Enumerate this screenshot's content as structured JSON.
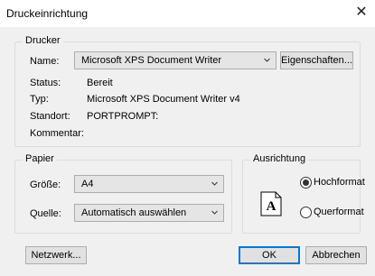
{
  "window": {
    "title": "Druckeinrichtung",
    "close_glyph": "✕"
  },
  "printer": {
    "group_label": "Drucker",
    "name_label": "Name:",
    "name_value": "Microsoft XPS Document Writer",
    "properties_button": "Eigenschaften...",
    "status_label": "Status:",
    "status_value": "Bereit",
    "type_label": "Typ:",
    "type_value": "Microsoft XPS Document Writer v4",
    "location_label": "Standort:",
    "location_value": "PORTPROMPT:",
    "comment_label": "Kommentar:",
    "comment_value": ""
  },
  "paper": {
    "group_label": "Papier",
    "size_label": "Größe:",
    "size_value": "A4",
    "source_label": "Quelle:",
    "source_value": "Automatisch auswählen"
  },
  "orientation": {
    "group_label": "Ausrichtung",
    "portrait_label": "Hochformat",
    "landscape_label": "Querformat",
    "selected": "Hochformat",
    "page_icon_letter": "A"
  },
  "buttons": {
    "network": "Netzwerk...",
    "ok": "OK",
    "cancel": "Abbrechen"
  },
  "icons": {
    "close": "close-icon",
    "dropdown": "chevron-down-icon",
    "orientation_preview": "portrait-page-icon"
  }
}
